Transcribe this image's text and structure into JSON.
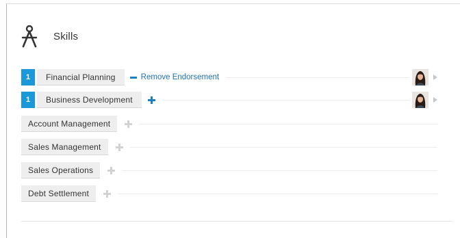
{
  "header": {
    "title": "Skills",
    "icon": "compass-icon"
  },
  "actions": {
    "remove_endorsement": "Remove Endorsement"
  },
  "skills": [
    {
      "name": "Financial Planning",
      "endorsement_count": "1",
      "endorsed_by_you": true
    },
    {
      "name": "Business Development",
      "endorsement_count": "1",
      "endorsed_by_you": false
    },
    {
      "name": "Account Management"
    },
    {
      "name": "Sales Management"
    },
    {
      "name": "Sales Operations"
    },
    {
      "name": "Debt Settlement"
    }
  ],
  "colors": {
    "accent": "#1b98d8",
    "link": "#1e73b5",
    "pill_bg": "#eeeeee",
    "plus_inactive": "#d2d2d2"
  }
}
